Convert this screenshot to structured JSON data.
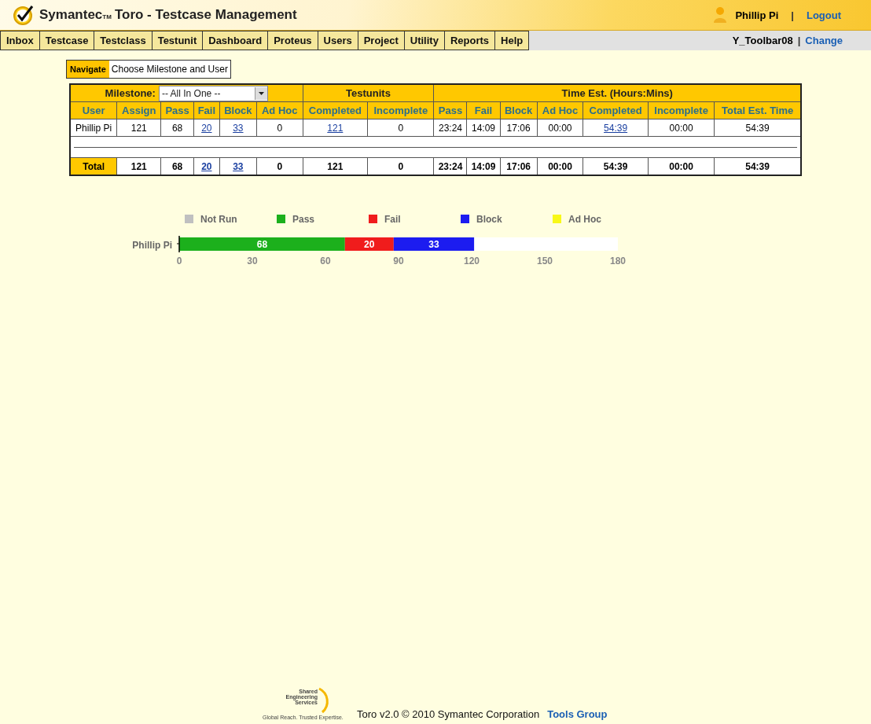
{
  "header": {
    "brand": "Symantec",
    "tm": "TM",
    "title": "Toro - Testcase Management",
    "user": "Phillip Pi",
    "separator": "|",
    "logout": "Logout"
  },
  "nav": {
    "items": [
      "Inbox",
      "Testcase",
      "Testclass",
      "Testunit",
      "Dashboard",
      "Proteus",
      "Users",
      "Project",
      "Utility",
      "Reports",
      "Help"
    ],
    "project": "Y_Toolbar08",
    "separator": "|",
    "change": "Change"
  },
  "navigate": {
    "label": "Navigate",
    "text": "Choose Milestone and User"
  },
  "table": {
    "milestone_label": "Milestone:",
    "milestone_value": "-- All In One --",
    "groups": [
      "Testunits",
      "Time Est. (Hours:Mins)"
    ],
    "columns": [
      "User",
      "Assign",
      "Pass",
      "Fail",
      "Block",
      "Ad Hoc",
      "Completed",
      "Incomplete",
      "Pass",
      "Fail",
      "Block",
      "Ad Hoc",
      "Completed",
      "Incomplete",
      "Total Est. Time"
    ],
    "rows": [
      [
        {
          "text": "Phillip Pi",
          "link": false
        },
        {
          "text": "121",
          "link": false
        },
        {
          "text": "68",
          "link": false
        },
        {
          "text": "20",
          "link": true
        },
        {
          "text": "33",
          "link": true
        },
        {
          "text": "0",
          "link": false
        },
        {
          "text": "121",
          "link": true
        },
        {
          "text": "0",
          "link": false
        },
        {
          "text": "23:24",
          "link": false
        },
        {
          "text": "14:09",
          "link": false
        },
        {
          "text": "17:06",
          "link": false
        },
        {
          "text": "00:00",
          "link": false
        },
        {
          "text": "54:39",
          "link": true
        },
        {
          "text": "00:00",
          "link": false
        },
        {
          "text": "54:39",
          "link": false
        }
      ]
    ],
    "total": [
      {
        "text": "Total",
        "link": false
      },
      {
        "text": "121",
        "link": false
      },
      {
        "text": "68",
        "link": false
      },
      {
        "text": "20",
        "link": true
      },
      {
        "text": "33",
        "link": true
      },
      {
        "text": "0",
        "link": false
      },
      {
        "text": "121",
        "link": false
      },
      {
        "text": "0",
        "link": false
      },
      {
        "text": "23:24",
        "link": false
      },
      {
        "text": "14:09",
        "link": false
      },
      {
        "text": "17:06",
        "link": false
      },
      {
        "text": "00:00",
        "link": false
      },
      {
        "text": "54:39",
        "link": false
      },
      {
        "text": "00:00",
        "link": false
      },
      {
        "text": "54:39",
        "link": false
      }
    ]
  },
  "chart_data": {
    "type": "bar",
    "orientation": "horizontal",
    "stacked": true,
    "legend": "top",
    "value_labels": [
      [
        null
      ],
      [
        "68"
      ],
      [
        "20"
      ],
      [
        "33"
      ],
      [
        null
      ]
    ],
    "categories": [
      "Phillip Pi"
    ],
    "xlim": [
      0,
      180
    ],
    "xticks": [
      0,
      30,
      60,
      90,
      120,
      150,
      180
    ],
    "series": [
      {
        "name": "Not Run",
        "color": "#c0c0c0",
        "values": [
          0
        ]
      },
      {
        "name": "Pass",
        "color": "#1cb01c",
        "values": [
          68
        ]
      },
      {
        "name": "Fail",
        "color": "#f01c1c",
        "values": [
          20
        ]
      },
      {
        "name": "Block",
        "color": "#1c1cf0",
        "values": [
          33
        ]
      },
      {
        "name": "Ad Hoc",
        "color": "#f8f818",
        "values": [
          0
        ]
      }
    ]
  },
  "footer": {
    "logo_lines": [
      "Shared",
      "Engineering",
      "Services"
    ],
    "logo_tagline": "Global Reach. Trusted Expertise.",
    "text": "Toro v2.0 © 2010 Symantec Corporation",
    "link": "Tools Group"
  }
}
